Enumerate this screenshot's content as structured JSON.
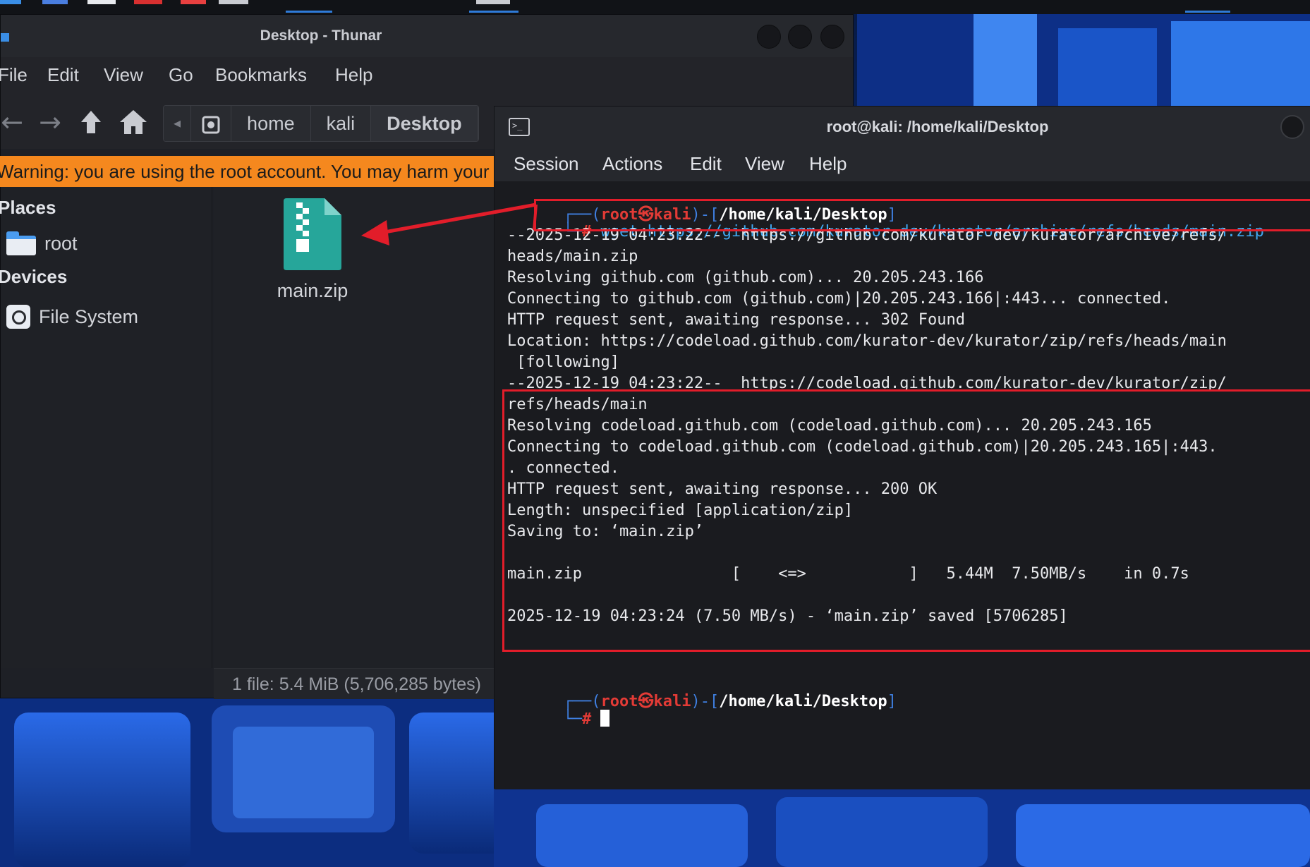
{
  "thunar": {
    "title": "Desktop - Thunar",
    "menu": [
      "File",
      "Edit",
      "View",
      "Go",
      "Bookmarks",
      "Help"
    ],
    "path": [
      "home",
      "kali",
      "Desktop"
    ],
    "warning": "Warning: you are using the root account. You may harm your system.",
    "sidebar": {
      "places_heading": "Places",
      "places": [
        {
          "label": "root",
          "icon": "folder-icon"
        }
      ],
      "devices_heading": "Devices",
      "devices": [
        {
          "label": "File System",
          "icon": "drive-icon"
        }
      ]
    },
    "files": [
      {
        "name": "main.zip",
        "icon": "zip-archive-icon"
      }
    ],
    "status": "1 file: 5.4 MiB (5,706,285 bytes)"
  },
  "terminal": {
    "title": "root@kali: /home/kali/Desktop",
    "menu": [
      "Session",
      "Actions",
      "Edit",
      "View",
      "Help"
    ],
    "prompt": {
      "open": "┌──(",
      "user": "root",
      "at": "㉿",
      "host": "kali",
      "mid": ")-[",
      "path": "/home/kali/Desktop",
      "close": "]",
      "corner": "└─",
      "hash": "#"
    },
    "command": "wget https://github.com/kurator-dev/kurator/archive/refs/heads/main.zip",
    "output": [
      "--2025-12-19 04:23:22--  https://github.com/kurator-dev/kurator/archive/refs/",
      "heads/main.zip",
      "Resolving github.com (github.com)... 20.205.243.166",
      "Connecting to github.com (github.com)|20.205.243.166|:443... connected.",
      "HTTP request sent, awaiting response... 302 Found",
      "Location: https://codeload.github.com/kurator-dev/kurator/zip/refs/heads/main",
      " [following]",
      "--2025-12-19 04:23:22--  https://codeload.github.com/kurator-dev/kurator/zip/",
      "refs/heads/main",
      "Resolving codeload.github.com (codeload.github.com)... 20.205.243.165",
      "Connecting to codeload.github.com (codeload.github.com)|20.205.243.165|:443.",
      ". connected.",
      "HTTP request sent, awaiting response... 200 OK",
      "Length: unspecified [application/zip]",
      "Saving to: ‘main.zip’",
      "",
      "main.zip                [    <=>           ]   5.44M  7.50MB/s    in 0.7s",
      "",
      "2025-12-19 04:23:24 (7.50 MB/s) - ‘main.zip’ saved [5706285]"
    ]
  },
  "colors": {
    "warning_bg": "#f5881e",
    "highlight": "#e21d2a",
    "prompt_user": "#e33b36",
    "prompt_bracket": "#3f7fe0"
  }
}
